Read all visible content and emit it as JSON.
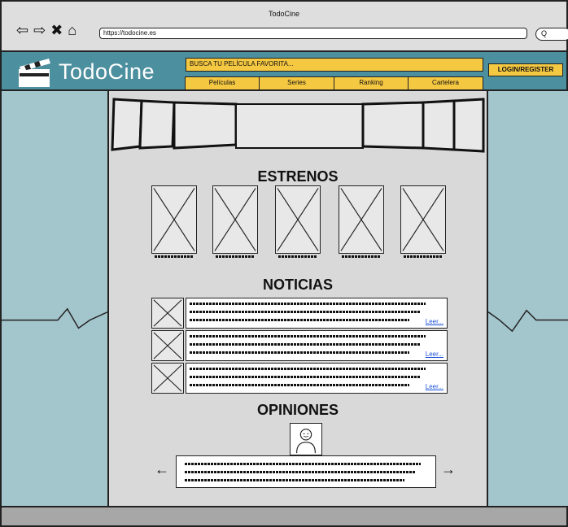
{
  "browser": {
    "window_title": "TodoCine",
    "url": "https://todocine.es",
    "nav_icons": [
      "back-arrow-icon",
      "forward-arrow-icon",
      "close-x-icon",
      "home-icon"
    ],
    "search_glyph": "Q"
  },
  "header": {
    "brand": "TodoCine",
    "search_placeholder": "BUSCA TU PELÍCULA FAVORITA...",
    "login_label": "LOGIN/REGISTER",
    "nav": [
      "Películas",
      "Series",
      "Ranking",
      "Cartelera"
    ]
  },
  "sections": {
    "estrenos": "ESTRENOS",
    "noticias": "NOTICIAS",
    "opiniones": "OPINIONES"
  },
  "news": [
    {
      "read_more": "Leer..."
    },
    {
      "read_more": "Leer..."
    },
    {
      "read_more": "Leer..."
    }
  ],
  "colors": {
    "header_teal": "#4c8f9e",
    "side_teal": "#a3c5cc",
    "accent_yellow": "#f5c842",
    "link_blue": "#1a4fd8"
  }
}
